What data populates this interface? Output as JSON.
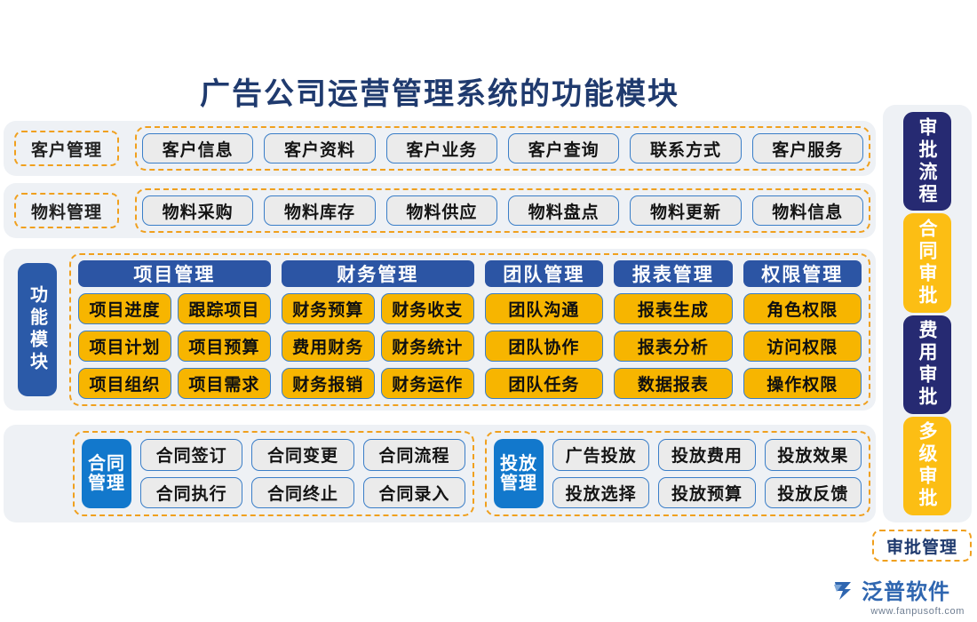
{
  "title": "广告公司运营管理系统的功能模块",
  "rows": [
    {
      "label": "客户管理",
      "items": [
        "客户信息",
        "客户资料",
        "客户业务",
        "客户查询",
        "联系方式",
        "客户服务"
      ]
    },
    {
      "label": "物料管理",
      "items": [
        "物料采购",
        "物料库存",
        "物料供应",
        "物料盘点",
        "物料更新",
        "物料信息"
      ]
    }
  ],
  "function_module": {
    "label": "功能模块",
    "columns": [
      {
        "head": "项目管理",
        "items": [
          "项目进度",
          "跟踪项目",
          "项目计划",
          "项目预算",
          "项目组织",
          "项目需求"
        ],
        "cols": 2
      },
      {
        "head": "财务管理",
        "items": [
          "财务预算",
          "财务收支",
          "费用财务",
          "财务统计",
          "财务报销",
          "财务运作"
        ],
        "cols": 2
      },
      {
        "head": "团队管理",
        "items": [
          "团队沟通",
          "团队协作",
          "团队任务"
        ],
        "cols": 1
      },
      {
        "head": "报表管理",
        "items": [
          "报表生成",
          "报表分析",
          "数据报表"
        ],
        "cols": 1
      },
      {
        "head": "权限管理",
        "items": [
          "角色权限",
          "访问权限",
          "操作权限"
        ],
        "cols": 1
      }
    ]
  },
  "bottom": [
    {
      "label": "合同管理",
      "items": [
        "合同签订",
        "合同变更",
        "合同流程",
        "合同执行",
        "合同终止",
        "合同录入"
      ]
    },
    {
      "label": "投放管理",
      "items": [
        "广告投放",
        "投放费用",
        "投放效果",
        "投放选择",
        "投放预算",
        "投放反馈"
      ]
    }
  ],
  "approval": {
    "caption": "审批管理",
    "items": [
      {
        "label": "审批流程",
        "style": "navy"
      },
      {
        "label": "合同审批",
        "style": "amber"
      },
      {
        "label": "费用审批",
        "style": "navy"
      },
      {
        "label": "多级审批",
        "style": "amber"
      }
    ]
  },
  "logo": {
    "name": "泛普软件",
    "url": "www.fanpusoft.com"
  },
  "colors": {
    "title": "#1f3a6e",
    "panel_bg": "#eef1f5",
    "dashed": "#f0a01e",
    "pill_border": "#3a7ec8",
    "pill_bg": "#ebebeb",
    "amber": "#f7b500",
    "header_blue": "#2c55a4",
    "tag_blue": "#1278cc",
    "navy": "#262a72"
  }
}
